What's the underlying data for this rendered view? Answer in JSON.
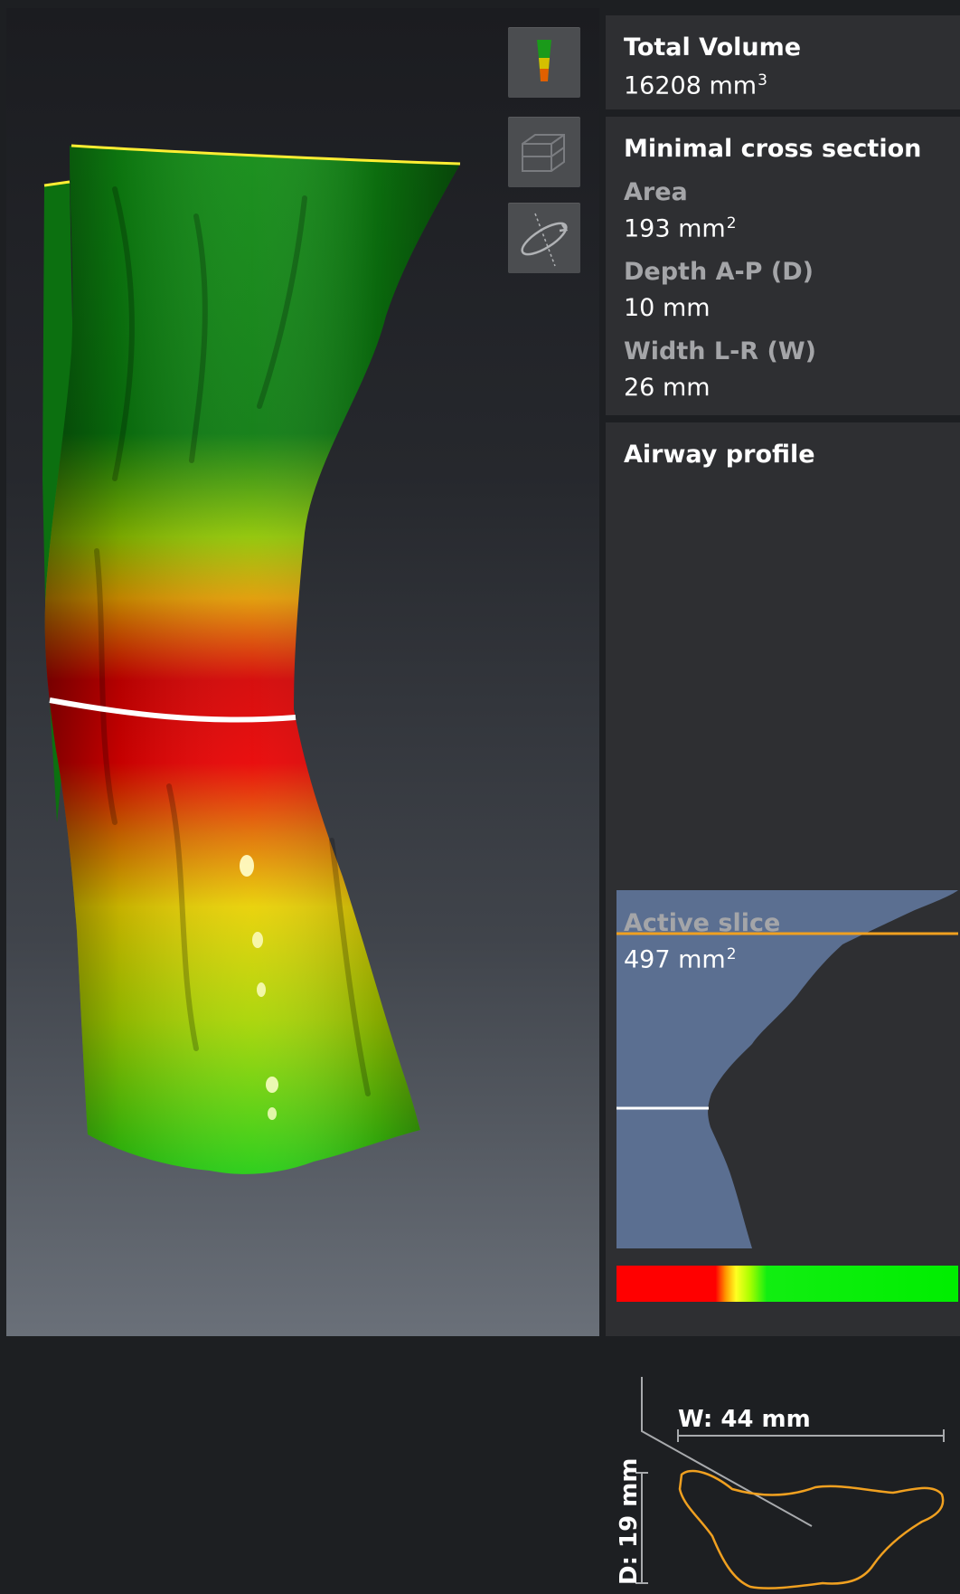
{
  "toolbar": {
    "items": [
      {
        "name": "airway-view",
        "icon": "airway-segmentation-icon",
        "active": true
      },
      {
        "name": "box-toggle",
        "icon": "bounding-box-icon",
        "active": false
      },
      {
        "name": "rotate-plane",
        "icon": "rotate-plane-icon",
        "active": false
      }
    ]
  },
  "total_volume": {
    "title": "Total Volume",
    "value": "16208 mm",
    "unit_exp": "3"
  },
  "minimal_cross_section": {
    "title": "Minimal cross section",
    "area_label": "Area",
    "area_value": "193 mm",
    "area_exp": "2",
    "depth_label": "Depth A-P (D)",
    "depth_value": "10 mm",
    "width_label": "Width L-R (W)",
    "width_value": "26 mm"
  },
  "airway_profile": {
    "title": "Airway profile",
    "fill_color": "#5b6f91",
    "active_slice_color": "#f0a020",
    "min_slice_color": "#ffffff",
    "active_slice_label": "Active slice",
    "active_slice_value": "497 mm",
    "active_slice_exp": "2",
    "width_dim": "W: 44 mm",
    "depth_dim": "D: 19 mm",
    "colormap": [
      "#ff0000",
      "#ffff22",
      "#00ee00"
    ]
  }
}
